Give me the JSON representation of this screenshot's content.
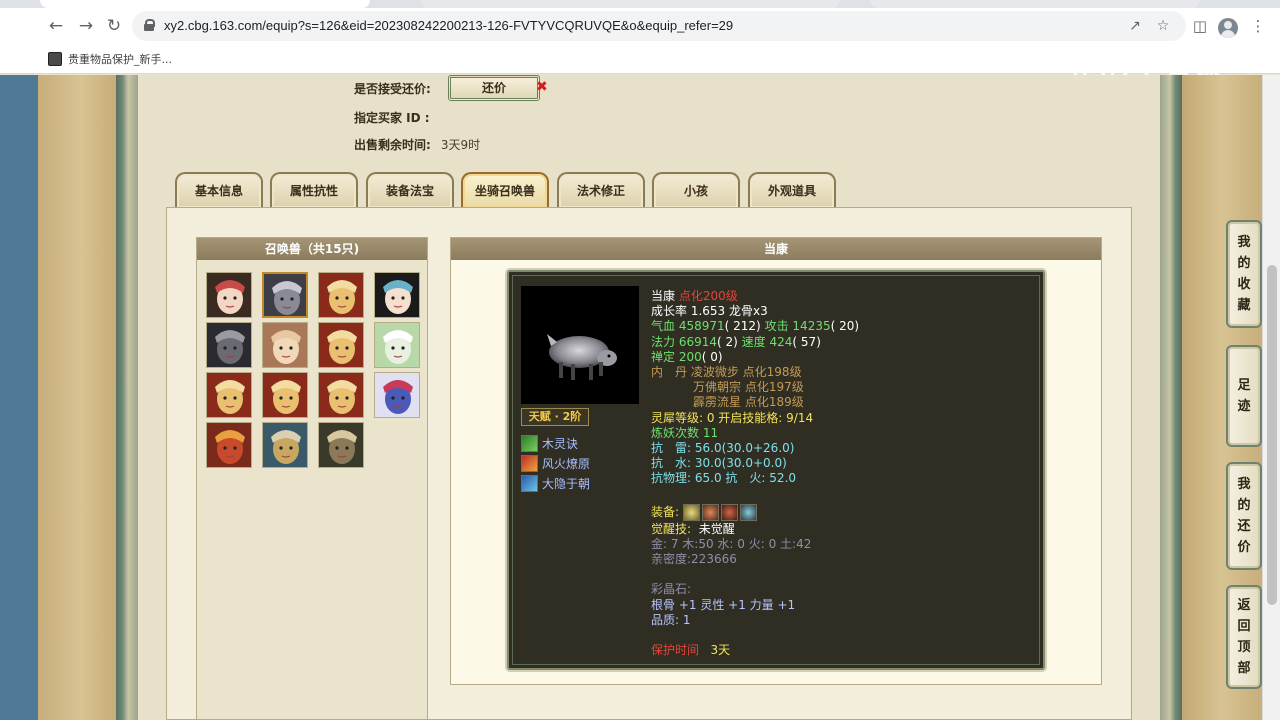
{
  "browser": {
    "url": "xy2.cbg.163.com/equip?s=126&eid=202308242200213-126-FVTYVCQRUVQE&o&equip_refer=29",
    "bookmark_label": "贵重物品保护_新手..."
  },
  "watermark": {
    "text": "CC直播"
  },
  "info": {
    "accept_counter_label": "是否接受还价:",
    "counter_button": "还价",
    "buyer_id_label": "指定买家 ID :",
    "time_left_label": "出售剩余时间:",
    "time_left_value": "3天9时"
  },
  "tabs": [
    {
      "label": "基本信息",
      "active": false
    },
    {
      "label": "属性抗性",
      "active": false
    },
    {
      "label": "装备法宝",
      "active": false
    },
    {
      "label": "坐骑召唤兽",
      "active": true
    },
    {
      "label": "法术修正",
      "active": false
    },
    {
      "label": "小孩",
      "active": false
    },
    {
      "label": "外观道具",
      "active": false
    }
  ],
  "summons": {
    "header": "召唤兽（共15只)",
    "selected_index": 1,
    "count": 15
  },
  "detail": {
    "header": "当康",
    "pet_name": "当康",
    "level": "点化200级",
    "growth": "成长率 1.653 龙骨x3",
    "hp_label": "气血",
    "hp": "458971",
    "hp_pts": "( 212)",
    "atk_label": "攻击",
    "atk": "14235",
    "atk_pts": "( 20)",
    "mp_label": "法力",
    "mp": "66914",
    "mp_pts": "( 2)",
    "spd_label": "速度",
    "spd": "424",
    "spd_pts": "( 57)",
    "dz_label": "禅定",
    "dz": "200",
    "dz_pts": "( 0)",
    "neidan_label": "内　丹",
    "neidan": [
      "凌波微步 点化198级",
      "万佛朝宗 点化197级",
      "霹雳流星 点化189级"
    ],
    "lingxi": "灵犀等级:  0 开启技能格:  9/14",
    "lianyao": "炼妖次数 11",
    "res_thunder_label": "抗　雷:",
    "res_thunder": "56.0(30.0+26.0)",
    "res_water_label": "抗　水:",
    "res_water": "30.0(30.0+0.0)",
    "res_phys_label": "抗物理:",
    "res_phys": "65.0",
    "res_fire_label": "抗　火:",
    "res_fire": "52.0",
    "equip_label": "装备:",
    "awaken_label": "觉醒技:",
    "awaken_value": "未觉醒",
    "elements": "金: 7 木:50 水: 0 火: 0 土:42",
    "intimacy": "亲密度:223666",
    "crystal_label": "彩晶石:",
    "crystal_stats": "根骨 +1 灵性 +1 力量 +1",
    "quality": "品质:  1",
    "protect_label": "保护时间",
    "protect_value": "3天",
    "talent": "天赋 · 2阶",
    "skills": [
      "木灵诀",
      "风火燎原",
      "大隐于朝"
    ]
  },
  "side_buttons": [
    [
      "我",
      "的",
      "收",
      "藏"
    ],
    [
      "足",
      "迹"
    ],
    [
      "我",
      "的",
      "还",
      "价"
    ],
    [
      "返",
      "回",
      "顶",
      "部"
    ]
  ]
}
